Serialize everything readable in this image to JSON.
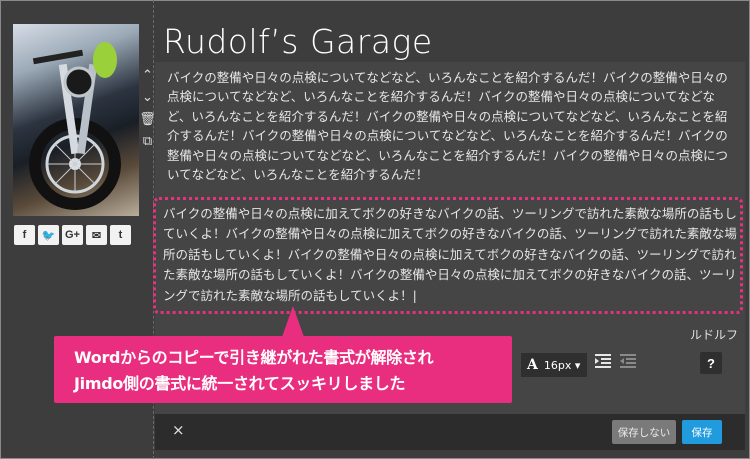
{
  "site": {
    "title": "Rudolf’s Garage"
  },
  "sidebar": {
    "social": [
      {
        "name": "facebook-icon",
        "glyph": "f"
      },
      {
        "name": "twitter-icon",
        "glyph": "🐦"
      },
      {
        "name": "google-plus-icon",
        "glyph": "G+"
      },
      {
        "name": "mail-icon",
        "glyph": "✉"
      },
      {
        "name": "tumblr-icon",
        "glyph": "t"
      }
    ]
  },
  "editor_controls": {
    "up": "⌃",
    "down": "⌄",
    "delete": "🗑",
    "copy": "⧉"
  },
  "content": {
    "paragraph1": "バイクの整備や日々の点検についてなどなど、いろんなことを紹介するんだ！バイクの整備や日々の点検についてなどなど、いろんなことを紹介するんだ！バイクの整備や日々の点検についてなどなど、いろんなことを紹介するんだ！バイクの整備や日々の点検についてなどなど、いろんなことを紹介するんだ！バイクの整備や日々の点検についてなどなど、いろんなことを紹介するんだ！バイクの整備や日々の点検についてなどなど、いろんなことを紹介するんだ！バイクの整備や日々の点検についてなどなど、いろんなことを紹介するんだ！",
    "paragraph2": "バイクの整備や日々の点検に加えてボクの好きなバイクの話、ツーリングで訪れた素敵な場所の話もしていくよ！バイクの整備や日々の点検に加えてボクの好きなバイクの話、ツーリングで訪れた素敵な場所の話もしていくよ！バイクの整備や日々の点検に加えてボクの好きなバイクの話、ツーリングで訪れた素敵な場所の話もしていくよ！バイクの整備や日々の点検に加えてボクの好きなバイクの話、ツーリングで訪れた素敵な場所の話もしていくよ！|",
    "author": "ルドルフ"
  },
  "toolbar": {
    "font_icon": "A",
    "font_size": "16px ▾",
    "help": "?",
    "list": "≡"
  },
  "bottom": {
    "close": "×",
    "no_save": "保存しない",
    "save": "保存"
  },
  "callout": {
    "line1": "Wordからのコピーで引き継がれた書式が解除され",
    "line2": "Jimdo側の書式に統一されてスッキリしました",
    "color": "#ea2e7f"
  },
  "colors": {
    "background": "#3d3d3d",
    "accent_blue": "#1f9bde",
    "dotted_border": "#e6327e"
  }
}
